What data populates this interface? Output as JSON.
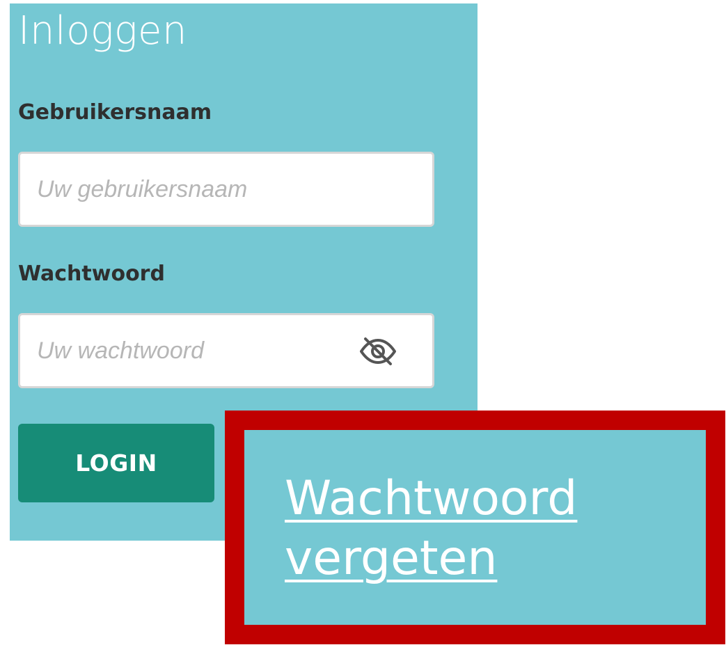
{
  "login_form": {
    "title": "Inloggen",
    "username": {
      "label": "Gebruikersnaam",
      "value": "",
      "placeholder": "Uw gebruikersnaam"
    },
    "password": {
      "label": "Wachtwoord",
      "value": "",
      "placeholder": "Uw wachtwoord",
      "toggle_icon": "eye-slash-icon"
    },
    "login_button_label": "LOGIN"
  },
  "callout": {
    "forgot_password_link": "Wachtwoord vergeten"
  },
  "colors": {
    "panel_background": "#75c8d3",
    "login_button": "#178c77",
    "callout_border": "#c00000",
    "title_text": "#ffffff",
    "label_text": "#2f2f2f",
    "placeholder_text": "#b6b6b6"
  }
}
